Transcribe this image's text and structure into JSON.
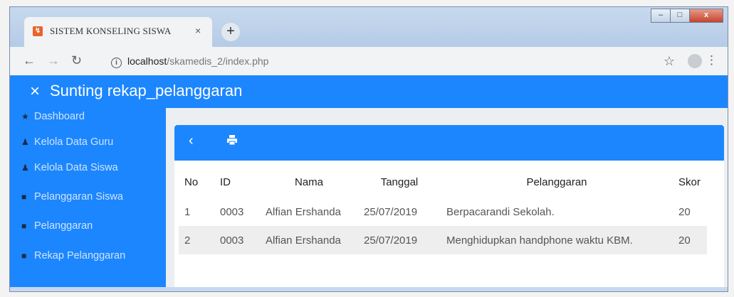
{
  "browser": {
    "tab_title": "SISTEM KONSELING SISWA",
    "tab_close": "×",
    "new_tab": "+",
    "favicon": "↯",
    "url_host": "localhost",
    "url_path": "/skamedis_2/index.php",
    "controls": {
      "minimize": "–",
      "maximize": "□",
      "close": "x"
    }
  },
  "app": {
    "close_symbol": "×",
    "title": "Sunting rekap_pelanggaran",
    "accent": "#1c86ff"
  },
  "sidebar": {
    "items": [
      {
        "label": "Dashboard",
        "icon": "home-icon"
      },
      {
        "label": "Kelola Data Guru",
        "icon": "user-icon"
      },
      {
        "label": "Kelola Data Siswa",
        "icon": "user-icon"
      },
      {
        "label": "Pelanggaran Siswa",
        "icon": "book-icon"
      },
      {
        "label": "Pelanggaran",
        "icon": "book-icon"
      },
      {
        "label": "Rekap Pelanggaran",
        "icon": "book-icon"
      }
    ]
  },
  "card": {
    "back_symbol": "‹",
    "print_icon": "print-icon"
  },
  "table": {
    "headers": [
      "No",
      "ID",
      "Nama",
      "Tanggal",
      "Pelanggaran",
      "Skor"
    ],
    "rows": [
      [
        "1",
        "0003",
        "Alfian Ershanda",
        "25/07/2019",
        "Berpacarandi Sekolah.",
        "20"
      ],
      [
        "2",
        "0003",
        "Alfian Ershanda",
        "25/07/2019",
        "Menghidupkan handphone waktu KBM.",
        "20"
      ]
    ]
  }
}
